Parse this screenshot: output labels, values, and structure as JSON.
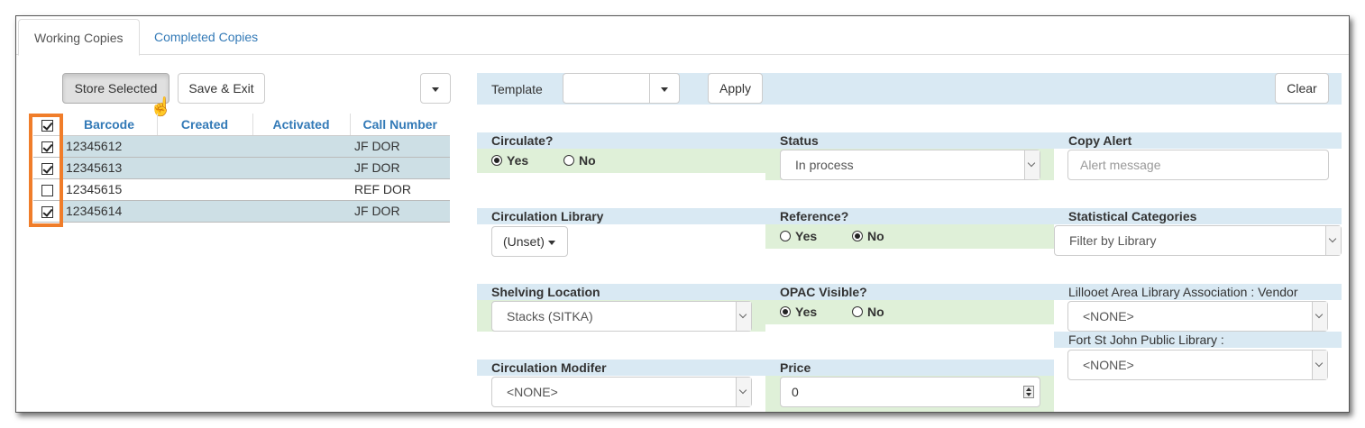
{
  "tabs": [
    {
      "label": "Working Copies",
      "active": true
    },
    {
      "label": "Completed Copies",
      "active": false
    }
  ],
  "toolbar": {
    "store_selected": "Store Selected",
    "save_exit": "Save & Exit"
  },
  "grid": {
    "columns": [
      "Barcode",
      "Created",
      "Activated",
      "Call Number"
    ],
    "header_checked": true,
    "rows": [
      {
        "checked": true,
        "barcode": "12345612",
        "created": "",
        "activated": "",
        "call_number": "JF DOR"
      },
      {
        "checked": true,
        "barcode": "12345613",
        "created": "",
        "activated": "",
        "call_number": "JF DOR"
      },
      {
        "checked": false,
        "barcode": "12345615",
        "created": "",
        "activated": "",
        "call_number": "REF DOR"
      },
      {
        "checked": true,
        "barcode": "12345614",
        "created": "",
        "activated": "",
        "call_number": "JF DOR"
      }
    ]
  },
  "template": {
    "label": "Template",
    "value": "",
    "apply": "Apply",
    "clear": "Clear"
  },
  "fields": {
    "circulate": {
      "label": "Circulate?",
      "yes": "Yes",
      "no": "No",
      "selected": "Yes"
    },
    "status": {
      "label": "Status",
      "value": "In process"
    },
    "copy_alert": {
      "label": "Copy Alert",
      "placeholder": "Alert message"
    },
    "circ_library": {
      "label": "Circulation Library",
      "value": "(Unset)"
    },
    "reference": {
      "label": "Reference?",
      "yes": "Yes",
      "no": "No",
      "selected": "No"
    },
    "stat_cats": {
      "label": "Statistical Categories",
      "value": "Filter by Library"
    },
    "shelving_location": {
      "label": "Shelving Location",
      "value": "Stacks (SITKA)"
    },
    "opac_visible": {
      "label": "OPAC Visible?",
      "yes": "Yes",
      "no": "No",
      "selected": "Yes"
    },
    "vendor": {
      "label": "Lillooet Area Library Association : Vendor",
      "value": "<NONE>"
    },
    "fort_st_john": {
      "label": "Fort St John Public Library :",
      "value": "<NONE>"
    },
    "circ_modifier": {
      "label": "Circulation Modifer",
      "value": "<NONE>"
    },
    "price": {
      "label": "Price",
      "value": "0"
    }
  },
  "icons": {
    "cursor": "hand-pointer-icon",
    "dropdown": "caret-down-icon"
  },
  "colors": {
    "highlight": "#f07d2a",
    "selected_row": "#cddfe5",
    "band_blue": "#d9e9f3",
    "band_green": "#dff0d8",
    "link": "#337ab7"
  }
}
